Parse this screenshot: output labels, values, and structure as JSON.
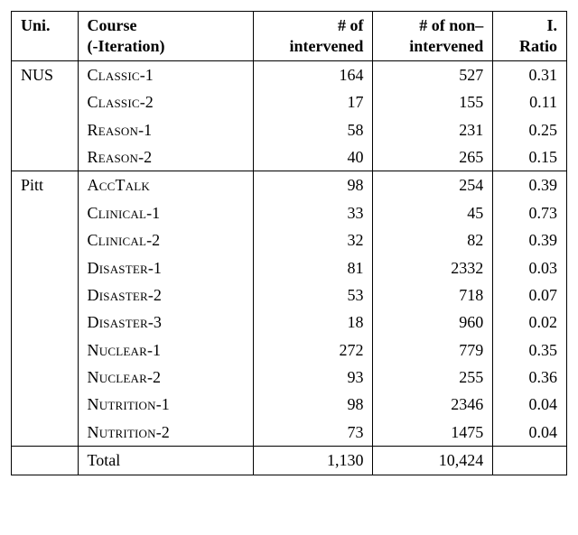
{
  "headers": {
    "uni1": "Uni.",
    "uni2": "",
    "course1": "Course",
    "course2": "(-Iteration)",
    "int1": "# of",
    "int2": "intervened",
    "nint1": "# of non–",
    "nint2": "intervened",
    "ratio1": "I.",
    "ratio2": "Ratio"
  },
  "groups": [
    {
      "uni": "NUS",
      "rows": [
        {
          "course_sc": "Classic",
          "suffix": "-1",
          "int": "164",
          "nint": "527",
          "ratio": "0.31"
        },
        {
          "course_sc": "Classic",
          "suffix": "-2",
          "int": "17",
          "nint": "155",
          "ratio": "0.11"
        },
        {
          "course_sc": "Reason",
          "suffix": "-1",
          "int": "58",
          "nint": "231",
          "ratio": "0.25"
        },
        {
          "course_sc": "Reason",
          "suffix": "-2",
          "int": "40",
          "nint": "265",
          "ratio": "0.15"
        }
      ]
    },
    {
      "uni": "Pitt",
      "rows": [
        {
          "course_sc": "AccTalk",
          "suffix": "",
          "int": "98",
          "nint": "254",
          "ratio": "0.39"
        },
        {
          "course_sc": "Clinical",
          "suffix": "-1",
          "int": "33",
          "nint": "45",
          "ratio": "0.73"
        },
        {
          "course_sc": "Clinical",
          "suffix": "-2",
          "int": "32",
          "nint": "82",
          "ratio": "0.39"
        },
        {
          "course_sc": "Disaster",
          "suffix": "-1",
          "int": "81",
          "nint": "2332",
          "ratio": "0.03"
        },
        {
          "course_sc": "Disaster",
          "suffix": "-2",
          "int": "53",
          "nint": "718",
          "ratio": "0.07"
        },
        {
          "course_sc": "Disaster",
          "suffix": "-3",
          "int": "18",
          "nint": "960",
          "ratio": "0.02"
        },
        {
          "course_sc": "Nuclear",
          "suffix": "-1",
          "int": "272",
          "nint": "779",
          "ratio": "0.35"
        },
        {
          "course_sc": "Nuclear",
          "suffix": "-2",
          "int": "93",
          "nint": "255",
          "ratio": "0.36"
        },
        {
          "course_sc": "Nutrition",
          "suffix": "-1",
          "int": "98",
          "nint": "2346",
          "ratio": "0.04"
        },
        {
          "course_sc": "Nutrition",
          "suffix": "-2",
          "int": "73",
          "nint": "1475",
          "ratio": "0.04"
        }
      ]
    }
  ],
  "total": {
    "label": "Total",
    "int": "1,130",
    "nint": "10,424",
    "ratio": ""
  }
}
